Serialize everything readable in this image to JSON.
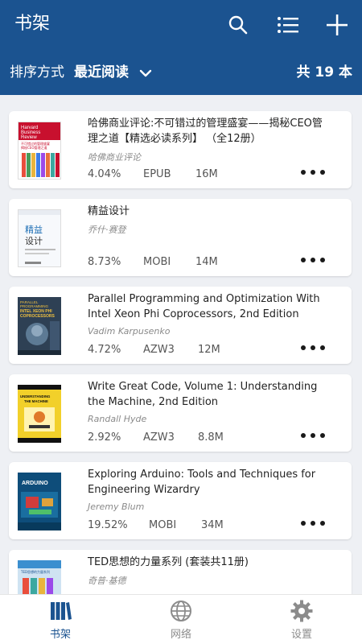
{
  "header": {
    "title": "书架",
    "search_icon": "search-icon",
    "list_icon": "list-icon",
    "add_icon": "plus-icon"
  },
  "sort": {
    "label": "排序方式",
    "value": "最近阅读",
    "count": "共 19 本"
  },
  "colors": {
    "primary": "#1b5390",
    "nav_active": "#1b5390",
    "nav_inactive": "#8c8c8c"
  },
  "books": [
    {
      "title": "哈佛商业评论:不可错过的管理盛宴——揭秘CEO管理之道【精选必读系列】 （全12册）",
      "author": "哈佛商业评论",
      "progress": "4.04%",
      "format": "EPUB",
      "size": "16M",
      "cover": {
        "line1": "Harvard",
        "line2": "Business",
        "line3": "Review",
        "line4": "不可错过的管理盛宴",
        "line5": "揭秘CEO管理之道"
      }
    },
    {
      "title": "精益设计",
      "author": "乔什·赛登",
      "progress": "8.73%",
      "format": "MOBI",
      "size": "14M",
      "cover": {
        "line1": "精益",
        "line2": "设计"
      }
    },
    {
      "title": "Parallel Programming and Optimization With Intel Xeon Phi Coprocessors, 2nd Edition",
      "author": "Vadim Karpusenko",
      "progress": "4.72%",
      "format": "AZW3",
      "size": "12M",
      "cover": {
        "line1": "PARALLEL",
        "line2": "PROGRAMMING",
        "line3": "INTEL XEON PHI",
        "line4": "COPROCESSORS"
      }
    },
    {
      "title": "Write Great Code, Volume 1: Understanding the Machine, 2nd Edition",
      "author": "Randall Hyde",
      "progress": "2.92%",
      "format": "AZW3",
      "size": "8.8M",
      "cover": {
        "line1": "UNDERSTANDING",
        "line2": "THE MACHINE"
      }
    },
    {
      "title": "Exploring Arduino: Tools and Techniques for Engineering Wizardry",
      "author": "Jeremy Blum",
      "progress": "19.52%",
      "format": "MOBI",
      "size": "34M",
      "cover": {
        "line1": "ARDUINO"
      }
    },
    {
      "title": "TED思想的力量系列 (套装共11册)",
      "author": "奇普·基德",
      "progress": "",
      "format": "",
      "size": "",
      "cover": {
        "line1": "TED思想的力量系列"
      }
    }
  ],
  "nav": [
    {
      "label": "书架",
      "icon": "bookshelf-icon",
      "active": true
    },
    {
      "label": "网络",
      "icon": "globe-icon",
      "active": false
    },
    {
      "label": "设置",
      "icon": "gear-icon",
      "active": false
    }
  ]
}
